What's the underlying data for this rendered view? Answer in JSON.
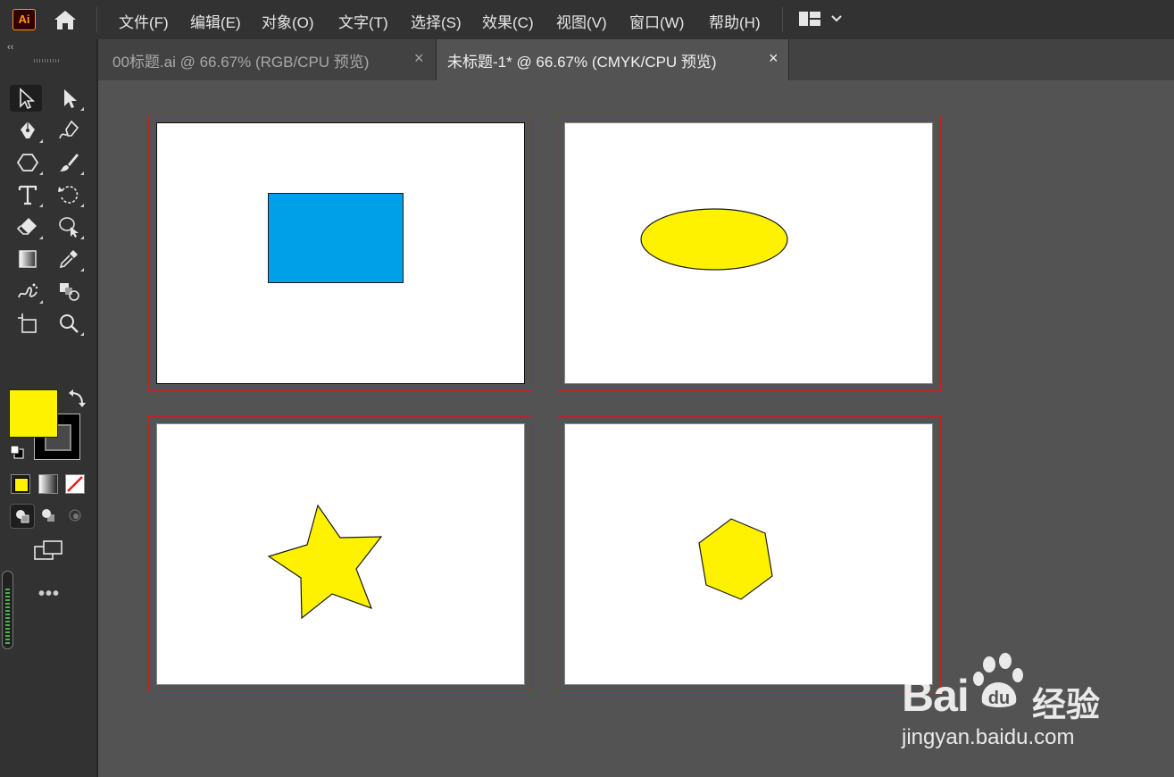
{
  "app": {
    "logo_text": "Ai"
  },
  "menu": {
    "items": [
      "文件(F)",
      "编辑(E)",
      "对象(O)",
      "文字(T)",
      "选择(S)",
      "效果(C)",
      "视图(V)",
      "窗口(W)",
      "帮助(H)"
    ]
  },
  "toolbar": {
    "collapse_label": "‹‹",
    "fill_color": "#fff200",
    "stroke_color": "#000000",
    "more_label": "•••"
  },
  "tabs": [
    {
      "label": "00标题.ai @ 66.67% (RGB/CPU 预览)",
      "close": "×",
      "active": false
    },
    {
      "label": "未标题-1* @ 66.67% (CMYK/CPU 预览)",
      "close": "×",
      "active": true
    }
  ],
  "artboards": [
    {
      "shape": "rectangle",
      "fill": "#00a0e9"
    },
    {
      "shape": "ellipse",
      "fill": "#fff200"
    },
    {
      "shape": "star",
      "fill": "#fff200"
    },
    {
      "shape": "hexagon",
      "fill": "#fff200"
    }
  ],
  "colors": {
    "artboard_border": "#c81e1e",
    "canvas": "#535353",
    "panel": "#323232"
  },
  "watermark": {
    "brand_left": "Bai",
    "brand_right": "经验",
    "url": "jingyan.baidu.com"
  }
}
